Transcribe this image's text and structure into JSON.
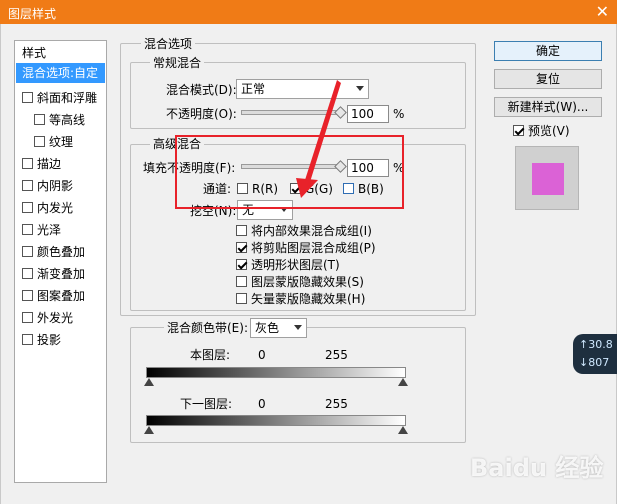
{
  "window": {
    "title": "图层样式"
  },
  "styles": {
    "header": "样式",
    "items": [
      {
        "label": "混合选项:自定",
        "checkbox": false,
        "selected": true,
        "indent": false
      },
      {
        "label": "斜面和浮雕",
        "checkbox": true,
        "checked": false,
        "indent": false
      },
      {
        "label": "等高线",
        "checkbox": true,
        "checked": false,
        "indent": true
      },
      {
        "label": "纹理",
        "checkbox": true,
        "checked": false,
        "indent": true
      },
      {
        "label": "描边",
        "checkbox": true,
        "checked": false,
        "indent": false
      },
      {
        "label": "内阴影",
        "checkbox": true,
        "checked": false,
        "indent": false
      },
      {
        "label": "内发光",
        "checkbox": true,
        "checked": false,
        "indent": false
      },
      {
        "label": "光泽",
        "checkbox": true,
        "checked": false,
        "indent": false
      },
      {
        "label": "颜色叠加",
        "checkbox": true,
        "checked": false,
        "indent": false
      },
      {
        "label": "渐变叠加",
        "checkbox": true,
        "checked": false,
        "indent": false
      },
      {
        "label": "图案叠加",
        "checkbox": true,
        "checked": false,
        "indent": false
      },
      {
        "label": "外发光",
        "checkbox": true,
        "checked": false,
        "indent": false
      },
      {
        "label": "投影",
        "checkbox": true,
        "checked": false,
        "indent": false
      }
    ]
  },
  "blend_options": {
    "section_title": "混合选项",
    "general": {
      "title": "常规混合",
      "blend_mode_label": "混合模式(D):",
      "blend_mode_value": "正常",
      "opacity_label": "不透明度(O):",
      "opacity_value": "100",
      "percent": "%"
    },
    "advanced": {
      "title": "高级混合",
      "fill_opacity_label": "填充不透明度(F):",
      "fill_opacity_value": "100",
      "percent": "%",
      "channels_label": "通道:",
      "channel_r": "R(R)",
      "channel_g": "G(G)",
      "channel_b": "B(B)",
      "knockout_label": "挖空(N):",
      "knockout_value": "无",
      "options": [
        {
          "label": "将内部效果混合成组(I)",
          "checked": false
        },
        {
          "label": "将剪贴图层混合成组(P)",
          "checked": true
        },
        {
          "label": "透明形状图层(T)",
          "checked": true
        },
        {
          "label": "图层蒙版隐藏效果(S)",
          "checked": false
        },
        {
          "label": "矢量蒙版隐藏效果(H)",
          "checked": false
        }
      ]
    },
    "blend_if": {
      "label": "混合颜色带(E):",
      "value": "灰色",
      "this_layer_label": "本图层:",
      "underlying_label": "下一图层:",
      "min": "0",
      "max": "255"
    }
  },
  "buttons": {
    "ok": "确定",
    "reset": "复位",
    "new_style": "新建样式(W)...",
    "preview_label": "预览(V)"
  },
  "network": {
    "up": "30.8",
    "down": "807"
  },
  "watermark": "Baidu 经验",
  "colors": {
    "titlebar": "#f07b16",
    "selection": "#3399ff",
    "preview_swatch": "#db62d6",
    "annotation": "#e8222a"
  }
}
